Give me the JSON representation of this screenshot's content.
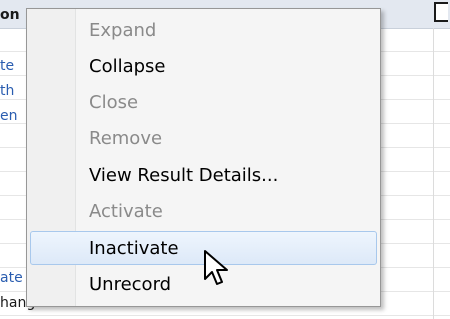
{
  "background": {
    "header_text": "on",
    "row_fragments": [
      "te",
      "th",
      "en",
      "ate",
      "hanged"
    ]
  },
  "context_menu": {
    "items": [
      {
        "label": "Expand",
        "enabled": false
      },
      {
        "label": "Collapse",
        "enabled": true
      },
      {
        "label": "Close",
        "enabled": false
      },
      {
        "label": "Remove",
        "enabled": false
      },
      {
        "label": "View Result Details...",
        "enabled": true
      },
      {
        "label": "Activate",
        "enabled": false
      },
      {
        "label": "Inactivate",
        "enabled": true,
        "hovered": true
      },
      {
        "label": "Unrecord",
        "enabled": true
      }
    ]
  },
  "cursor": {
    "icon": "arrow-pointer-icon"
  },
  "colors": {
    "link_text": "#2a5db0",
    "disabled_text": "#8a8a8a",
    "hover_border": "#a8c8ec",
    "menu_background": "#f5f5f5"
  }
}
